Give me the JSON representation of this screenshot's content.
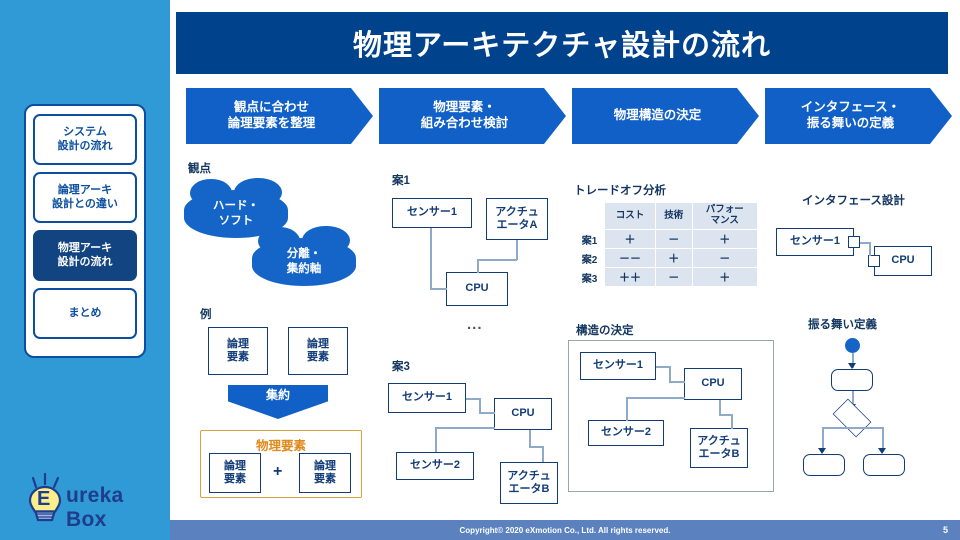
{
  "slide": {
    "title": "物理アーキテクチャ設計の流れ",
    "page_number": "5",
    "copyright": "Copyright© 2020 eXmotion Co., Ltd. All rights reserved."
  },
  "colors": {
    "panel_blue": "#2F9AD6",
    "title_navy": "#00428C",
    "chevron_blue": "#1060C8",
    "box_navy": "#123C78",
    "orange": "#E08A1E",
    "footer_blue": "#5B82BE",
    "table_header": "#DCE4F0"
  },
  "sidebar": {
    "items": [
      {
        "label": "システム\n設計の流れ",
        "active": false
      },
      {
        "label": "論理アーキ\n設計との違い",
        "active": false
      },
      {
        "label": "物理アーキ\n設計の流れ",
        "active": true
      },
      {
        "label": "まとめ",
        "active": false
      }
    ]
  },
  "logo": {
    "text": "ureka Box",
    "bulb_letter": "E"
  },
  "process": {
    "steps": [
      {
        "label": "観点に合わせ\n論理要素を整理"
      },
      {
        "label": "物理要素・\n組み合わせ検討"
      },
      {
        "label": "物理構造の決定"
      },
      {
        "label": "インタフェース・\n振る舞いの定義"
      }
    ]
  },
  "viewpoint": {
    "heading": "観点",
    "clouds": [
      {
        "label": "ハード・\nソフト"
      },
      {
        "label": "分離・\n集約軸"
      }
    ]
  },
  "example": {
    "heading": "例",
    "logical_top": [
      {
        "label": "論理\n要素"
      },
      {
        "label": "論理\n要素"
      }
    ],
    "arrow_label": "集約",
    "physical": {
      "title": "物理要素",
      "parts": [
        {
          "label": "論理\n要素"
        },
        {
          "label": "論理\n要素"
        }
      ],
      "operator": "+"
    }
  },
  "plan1": {
    "heading": "案1",
    "nodes": {
      "sensor1": "センサー1",
      "actuatorA": "アクチュ\nエータA",
      "cpu": "CPU"
    },
    "ellipsis": "..."
  },
  "plan3": {
    "heading": "案3",
    "nodes": {
      "sensor1": "センサー1",
      "sensor2": "センサー2",
      "cpu": "CPU",
      "actuatorB": "アクチュ\nエータB"
    }
  },
  "tradeoff": {
    "heading": "トレードオフ分析",
    "columns": [
      "",
      "コスト",
      "技術",
      "パフォー\nマンス"
    ],
    "rows": [
      {
        "name": "案1",
        "values": [
          "＋",
          "－",
          "＋"
        ]
      },
      {
        "name": "案2",
        "values": [
          "－－",
          "＋",
          "－"
        ]
      },
      {
        "name": "案3",
        "values": [
          "＋＋",
          "－",
          "＋"
        ]
      }
    ]
  },
  "structure": {
    "heading": "構造の決定",
    "nodes": {
      "sensor1": "センサー1",
      "sensor2": "センサー2",
      "cpu": "CPU",
      "actuatorB": "アクチュ\nエータB"
    }
  },
  "interface": {
    "heading": "インタフェース設計",
    "nodes": {
      "sensor1": "センサー1",
      "cpu": "CPU"
    }
  },
  "behavior": {
    "heading": "振る舞い定義",
    "nodes": {
      "action": "",
      "decision": "",
      "branch_left": "",
      "branch_right": ""
    }
  }
}
